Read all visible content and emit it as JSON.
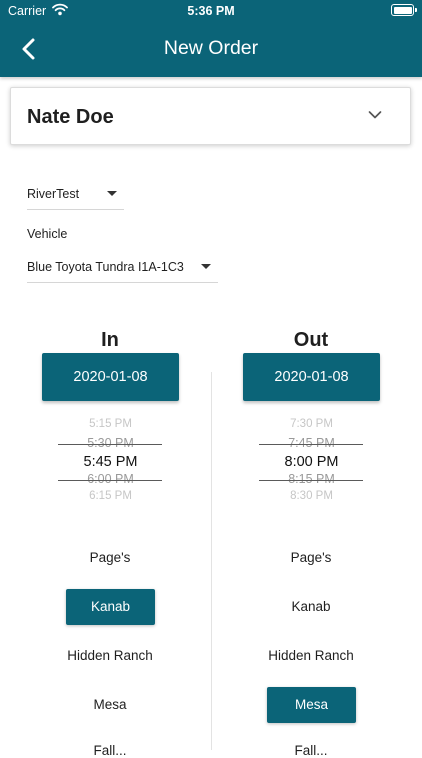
{
  "status_bar": {
    "carrier": "Carrier",
    "time": "5:36 PM",
    "wifi_icon": "wifi-icon",
    "battery_icon": "battery-icon"
  },
  "header": {
    "title": "New Order",
    "back_icon": "chevron-left-icon",
    "background": "#0b6478"
  },
  "customer": {
    "name": "Nate Doe",
    "expand_icon": "chevron-down-icon"
  },
  "account_select": {
    "value": "RiverTest"
  },
  "vehicle": {
    "label": "Vehicle",
    "value": "Blue Toyota Tundra I1A-1C3"
  },
  "in": {
    "title": "In",
    "date": "2020-01-08",
    "times": [
      "5:15 PM",
      "5:30 PM",
      "5:45 PM",
      "6:00 PM",
      "6:15 PM"
    ],
    "selected_time": "5:45 PM",
    "locations": [
      "Page's",
      "Kanab",
      "Hidden Ranch",
      "Mesa",
      "Fall..."
    ],
    "selected_location": "Kanab"
  },
  "out": {
    "title": "Out",
    "date": "2020-01-08",
    "times": [
      "7:30 PM",
      "7:45 PM",
      "8:00 PM",
      "8:15 PM",
      "8:30 PM"
    ],
    "selected_time": "8:00 PM",
    "locations": [
      "Page's",
      "Kanab",
      "Hidden Ranch",
      "Mesa",
      "Fall..."
    ],
    "selected_location": "Mesa"
  }
}
